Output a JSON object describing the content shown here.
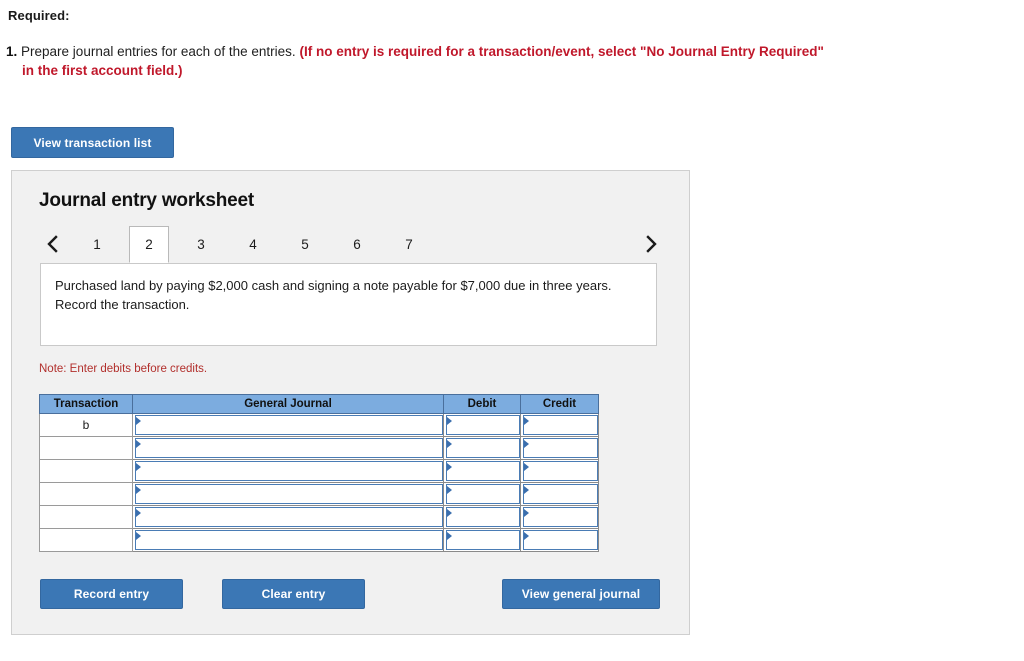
{
  "required": {
    "heading": "Required:",
    "item_number": "1.",
    "item_text": "Prepare journal entries for each of the entries.",
    "item_emphasis_line1": "(If no entry is required for a transaction/event, select \"No Journal Entry Required\"",
    "item_emphasis_line2": "in the first account field.)",
    "emphasis_color": "#c0182b"
  },
  "toolbar": {
    "view_transaction_list_label": "View transaction list"
  },
  "worksheet": {
    "title": "Journal entry worksheet",
    "prev_icon": "chevron-left-icon",
    "next_icon": "chevron-right-icon",
    "tabs": [
      {
        "label": "1",
        "active": false
      },
      {
        "label": "2",
        "active": true
      },
      {
        "label": "3",
        "active": false
      },
      {
        "label": "4",
        "active": false
      },
      {
        "label": "5",
        "active": false
      },
      {
        "label": "6",
        "active": false
      },
      {
        "label": "7",
        "active": false
      }
    ],
    "description": "Purchased land by paying $2,000 cash and signing a note payable for $7,000 due in three years. Record the transaction.",
    "note": "Note: Enter debits before credits.",
    "note_color": "#b2302d",
    "table": {
      "headers": [
        "Transaction",
        "General Journal",
        "Debit",
        "Credit"
      ],
      "header_bg": "#7cacdf",
      "rows": [
        {
          "transaction": "b",
          "general_journal": "",
          "debit": "",
          "credit": ""
        },
        {
          "transaction": "",
          "general_journal": "",
          "debit": "",
          "credit": ""
        },
        {
          "transaction": "",
          "general_journal": "",
          "debit": "",
          "credit": ""
        },
        {
          "transaction": "",
          "general_journal": "",
          "debit": "",
          "credit": ""
        },
        {
          "transaction": "",
          "general_journal": "",
          "debit": "",
          "credit": ""
        },
        {
          "transaction": "",
          "general_journal": "",
          "debit": "",
          "credit": ""
        }
      ]
    },
    "buttons": {
      "record_entry_label": "Record entry",
      "clear_entry_label": "Clear entry",
      "view_general_journal_label": "View general journal",
      "accent_color": "#3b77b5"
    }
  }
}
